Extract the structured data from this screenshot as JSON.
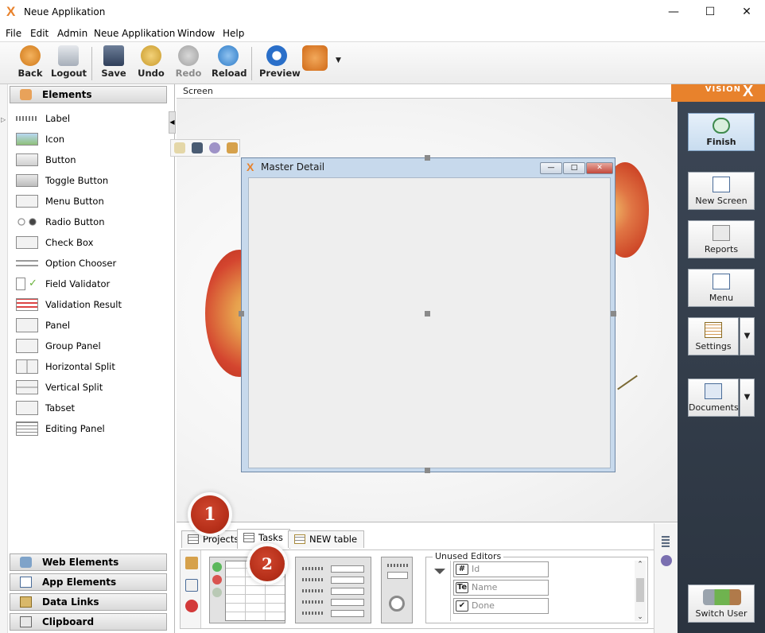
{
  "window": {
    "title": "Neue Applikation",
    "icon": "x-logo-icon"
  },
  "menu": [
    "File",
    "Edit",
    "Admin",
    "Neue Applikation",
    "Window",
    "Help"
  ],
  "toolbar": {
    "back": "Back",
    "logout": "Logout",
    "save": "Save",
    "undo": "Undo",
    "redo": "Redo",
    "reload": "Reload",
    "preview": "Preview"
  },
  "left_panel": {
    "elements_header": "Elements",
    "items": [
      {
        "label": "Label",
        "icon": "label-icon"
      },
      {
        "label": "Icon",
        "icon": "image-icon"
      },
      {
        "label": "Button",
        "icon": "button-icon"
      },
      {
        "label": "Toggle Button",
        "icon": "toggle-button-icon"
      },
      {
        "label": "Menu Button",
        "icon": "menu-button-icon"
      },
      {
        "label": "Radio Button",
        "icon": "radio-button-icon"
      },
      {
        "label": "Check Box",
        "icon": "checkbox-icon"
      },
      {
        "label": "Option Chooser",
        "icon": "option-chooser-icon"
      },
      {
        "label": "Field Validator",
        "icon": "field-validator-icon"
      },
      {
        "label": "Validation Result",
        "icon": "validation-result-icon"
      },
      {
        "label": "Panel",
        "icon": "panel-icon"
      },
      {
        "label": "Group Panel",
        "icon": "group-panel-icon"
      },
      {
        "label": "Horizontal Split",
        "icon": "horizontal-split-icon"
      },
      {
        "label": "Vertical Split",
        "icon": "vertical-split-icon"
      },
      {
        "label": "Tabset",
        "icon": "tabset-icon"
      },
      {
        "label": "Editing Panel",
        "icon": "editing-panel-icon"
      }
    ],
    "web_elements": "Web Elements",
    "app_elements": "App Elements",
    "data_links": "Data Links",
    "clipboard": "Clipboard"
  },
  "canvas": {
    "breadcrumb": "Screen",
    "inner_window_title": "Master Detail"
  },
  "bottom": {
    "tabs": [
      "Projects",
      "Tasks",
      "NEW table"
    ],
    "active_tab": "Tasks",
    "badges": [
      "1",
      "2"
    ],
    "unused_editors": {
      "title": "Unused Editors",
      "items": [
        {
          "label": "Id",
          "icon_text": "#"
        },
        {
          "label": "Name",
          "icon_text": "Te"
        },
        {
          "label": "Done",
          "icon_text": "✔"
        }
      ]
    }
  },
  "right_bar": {
    "brand": "VISION",
    "finish": "Finish",
    "new_screen": "New Screen",
    "reports": "Reports",
    "menu": "Menu",
    "settings": "Settings",
    "documents": "Documents",
    "switch_user": "Switch User"
  },
  "colors": {
    "accent": "#e8822c",
    "sidebar_dark": "#2f3946",
    "badge_red": "#b7301a"
  }
}
